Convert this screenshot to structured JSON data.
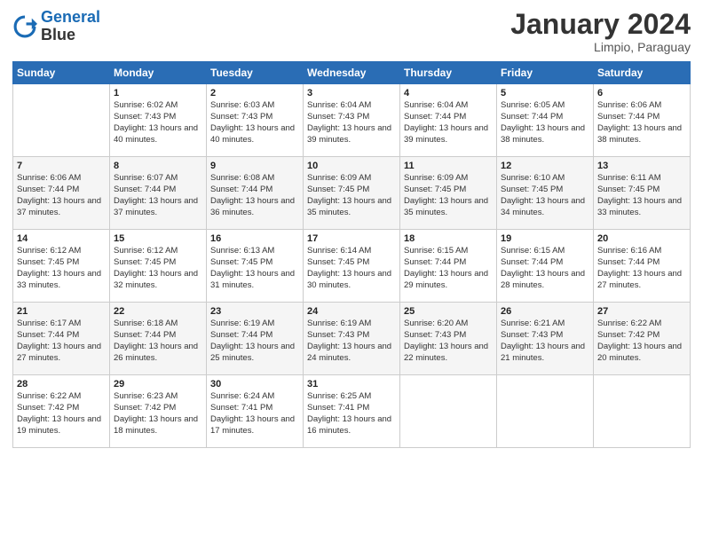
{
  "logo": {
    "line1": "General",
    "line2": "Blue"
  },
  "header": {
    "month": "January 2024",
    "location": "Limpio, Paraguay"
  },
  "weekdays": [
    "Sunday",
    "Monday",
    "Tuesday",
    "Wednesday",
    "Thursday",
    "Friday",
    "Saturday"
  ],
  "weeks": [
    [
      {
        "day": "",
        "sunrise": "",
        "sunset": "",
        "daylight": ""
      },
      {
        "day": "1",
        "sunrise": "Sunrise: 6:02 AM",
        "sunset": "Sunset: 7:43 PM",
        "daylight": "Daylight: 13 hours and 40 minutes."
      },
      {
        "day": "2",
        "sunrise": "Sunrise: 6:03 AM",
        "sunset": "Sunset: 7:43 PM",
        "daylight": "Daylight: 13 hours and 40 minutes."
      },
      {
        "day": "3",
        "sunrise": "Sunrise: 6:04 AM",
        "sunset": "Sunset: 7:43 PM",
        "daylight": "Daylight: 13 hours and 39 minutes."
      },
      {
        "day": "4",
        "sunrise": "Sunrise: 6:04 AM",
        "sunset": "Sunset: 7:44 PM",
        "daylight": "Daylight: 13 hours and 39 minutes."
      },
      {
        "day": "5",
        "sunrise": "Sunrise: 6:05 AM",
        "sunset": "Sunset: 7:44 PM",
        "daylight": "Daylight: 13 hours and 38 minutes."
      },
      {
        "day": "6",
        "sunrise": "Sunrise: 6:06 AM",
        "sunset": "Sunset: 7:44 PM",
        "daylight": "Daylight: 13 hours and 38 minutes."
      }
    ],
    [
      {
        "day": "7",
        "sunrise": "Sunrise: 6:06 AM",
        "sunset": "Sunset: 7:44 PM",
        "daylight": "Daylight: 13 hours and 37 minutes."
      },
      {
        "day": "8",
        "sunrise": "Sunrise: 6:07 AM",
        "sunset": "Sunset: 7:44 PM",
        "daylight": "Daylight: 13 hours and 37 minutes."
      },
      {
        "day": "9",
        "sunrise": "Sunrise: 6:08 AM",
        "sunset": "Sunset: 7:44 PM",
        "daylight": "Daylight: 13 hours and 36 minutes."
      },
      {
        "day": "10",
        "sunrise": "Sunrise: 6:09 AM",
        "sunset": "Sunset: 7:45 PM",
        "daylight": "Daylight: 13 hours and 35 minutes."
      },
      {
        "day": "11",
        "sunrise": "Sunrise: 6:09 AM",
        "sunset": "Sunset: 7:45 PM",
        "daylight": "Daylight: 13 hours and 35 minutes."
      },
      {
        "day": "12",
        "sunrise": "Sunrise: 6:10 AM",
        "sunset": "Sunset: 7:45 PM",
        "daylight": "Daylight: 13 hours and 34 minutes."
      },
      {
        "day": "13",
        "sunrise": "Sunrise: 6:11 AM",
        "sunset": "Sunset: 7:45 PM",
        "daylight": "Daylight: 13 hours and 33 minutes."
      }
    ],
    [
      {
        "day": "14",
        "sunrise": "Sunrise: 6:12 AM",
        "sunset": "Sunset: 7:45 PM",
        "daylight": "Daylight: 13 hours and 33 minutes."
      },
      {
        "day": "15",
        "sunrise": "Sunrise: 6:12 AM",
        "sunset": "Sunset: 7:45 PM",
        "daylight": "Daylight: 13 hours and 32 minutes."
      },
      {
        "day": "16",
        "sunrise": "Sunrise: 6:13 AM",
        "sunset": "Sunset: 7:45 PM",
        "daylight": "Daylight: 13 hours and 31 minutes."
      },
      {
        "day": "17",
        "sunrise": "Sunrise: 6:14 AM",
        "sunset": "Sunset: 7:45 PM",
        "daylight": "Daylight: 13 hours and 30 minutes."
      },
      {
        "day": "18",
        "sunrise": "Sunrise: 6:15 AM",
        "sunset": "Sunset: 7:44 PM",
        "daylight": "Daylight: 13 hours and 29 minutes."
      },
      {
        "day": "19",
        "sunrise": "Sunrise: 6:15 AM",
        "sunset": "Sunset: 7:44 PM",
        "daylight": "Daylight: 13 hours and 28 minutes."
      },
      {
        "day": "20",
        "sunrise": "Sunrise: 6:16 AM",
        "sunset": "Sunset: 7:44 PM",
        "daylight": "Daylight: 13 hours and 27 minutes."
      }
    ],
    [
      {
        "day": "21",
        "sunrise": "Sunrise: 6:17 AM",
        "sunset": "Sunset: 7:44 PM",
        "daylight": "Daylight: 13 hours and 27 minutes."
      },
      {
        "day": "22",
        "sunrise": "Sunrise: 6:18 AM",
        "sunset": "Sunset: 7:44 PM",
        "daylight": "Daylight: 13 hours and 26 minutes."
      },
      {
        "day": "23",
        "sunrise": "Sunrise: 6:19 AM",
        "sunset": "Sunset: 7:44 PM",
        "daylight": "Daylight: 13 hours and 25 minutes."
      },
      {
        "day": "24",
        "sunrise": "Sunrise: 6:19 AM",
        "sunset": "Sunset: 7:43 PM",
        "daylight": "Daylight: 13 hours and 24 minutes."
      },
      {
        "day": "25",
        "sunrise": "Sunrise: 6:20 AM",
        "sunset": "Sunset: 7:43 PM",
        "daylight": "Daylight: 13 hours and 22 minutes."
      },
      {
        "day": "26",
        "sunrise": "Sunrise: 6:21 AM",
        "sunset": "Sunset: 7:43 PM",
        "daylight": "Daylight: 13 hours and 21 minutes."
      },
      {
        "day": "27",
        "sunrise": "Sunrise: 6:22 AM",
        "sunset": "Sunset: 7:42 PM",
        "daylight": "Daylight: 13 hours and 20 minutes."
      }
    ],
    [
      {
        "day": "28",
        "sunrise": "Sunrise: 6:22 AM",
        "sunset": "Sunset: 7:42 PM",
        "daylight": "Daylight: 13 hours and 19 minutes."
      },
      {
        "day": "29",
        "sunrise": "Sunrise: 6:23 AM",
        "sunset": "Sunset: 7:42 PM",
        "daylight": "Daylight: 13 hours and 18 minutes."
      },
      {
        "day": "30",
        "sunrise": "Sunrise: 6:24 AM",
        "sunset": "Sunset: 7:41 PM",
        "daylight": "Daylight: 13 hours and 17 minutes."
      },
      {
        "day": "31",
        "sunrise": "Sunrise: 6:25 AM",
        "sunset": "Sunset: 7:41 PM",
        "daylight": "Daylight: 13 hours and 16 minutes."
      },
      {
        "day": "",
        "sunrise": "",
        "sunset": "",
        "daylight": ""
      },
      {
        "day": "",
        "sunrise": "",
        "sunset": "",
        "daylight": ""
      },
      {
        "day": "",
        "sunrise": "",
        "sunset": "",
        "daylight": ""
      }
    ]
  ]
}
